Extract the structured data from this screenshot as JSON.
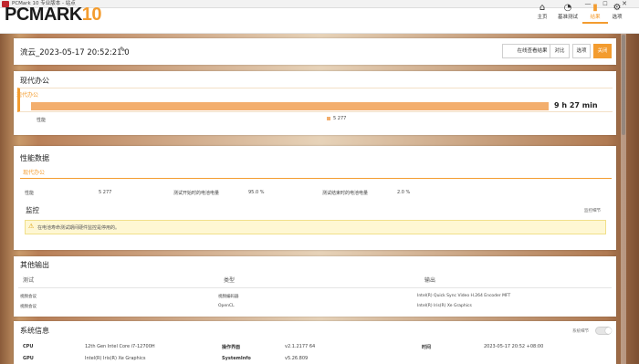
{
  "window": {
    "title": "PCMark 10 专业版本 - 站点",
    "minimize": "—",
    "maximize": "☐",
    "close": "✕"
  },
  "logo": {
    "main": "PCMARK",
    "num": "10"
  },
  "nav": [
    {
      "label": "主页",
      "icon": "home-icon",
      "glyph": "⌂"
    },
    {
      "label": "基准测试",
      "icon": "gauge-icon",
      "glyph": "◔"
    },
    {
      "label": "结果",
      "icon": "bar-chart-icon",
      "glyph": "▮"
    },
    {
      "label": "选项",
      "icon": "gear-icon",
      "glyph": "⚙"
    }
  ],
  "result": {
    "name": "流云_2023-05-17 20:52:21.0",
    "edit_glyph": "✎",
    "buttons": {
      "online": "在线查看结果",
      "compare": "对比",
      "options": "选项",
      "close": "关闭"
    }
  },
  "office": {
    "title": "现代办公",
    "subtitle": "现代办公",
    "duration": "9 h 27 min",
    "legend_label": "性能",
    "legend_value": "5 277"
  },
  "perf": {
    "title": "性能数据",
    "subtitle": "现代办公",
    "perf_label": "性能",
    "perf_value": "5 277",
    "start_label": "测试开始时的电池电量",
    "start_value": "95.0 %",
    "end_label": "测试结束时的电池电量",
    "end_value": "2.0 %",
    "monitor_title": "监控",
    "monitor_detail": "监控细节",
    "warning_glyph": "⚠",
    "warning": "在电池寿命测试期间硬件监控是停用的。"
  },
  "other": {
    "title": "其他输出",
    "headers": {
      "test": "测试",
      "type": "类型",
      "output": "输出"
    },
    "rows": [
      {
        "test": "视频会议",
        "type": "视频编码器",
        "output": "Intel(R) Quick Sync Video H.264 Encoder MFT"
      },
      {
        "test": "视频会议",
        "type": "OpenCL",
        "output": "Intel(R) Iris(R) Xe Graphics"
      }
    ]
  },
  "sysinfo": {
    "title": "系统信息",
    "toggle_label": "系统细节",
    "rows": [
      [
        {
          "k": "CPU",
          "v": "12th Gen Intel Core i7-12700H"
        },
        {
          "k": "操作界面",
          "v": "v2.1.2177 64"
        },
        {
          "k": "时间",
          "v": "2023-05-17 20:52 +08:00"
        }
      ],
      [
        {
          "k": "GPU",
          "v": "Intel(R) Iris(R) Xe Graphics"
        },
        {
          "k": "SystemInfo",
          "v": "v5.26.809"
        }
      ]
    ]
  }
}
